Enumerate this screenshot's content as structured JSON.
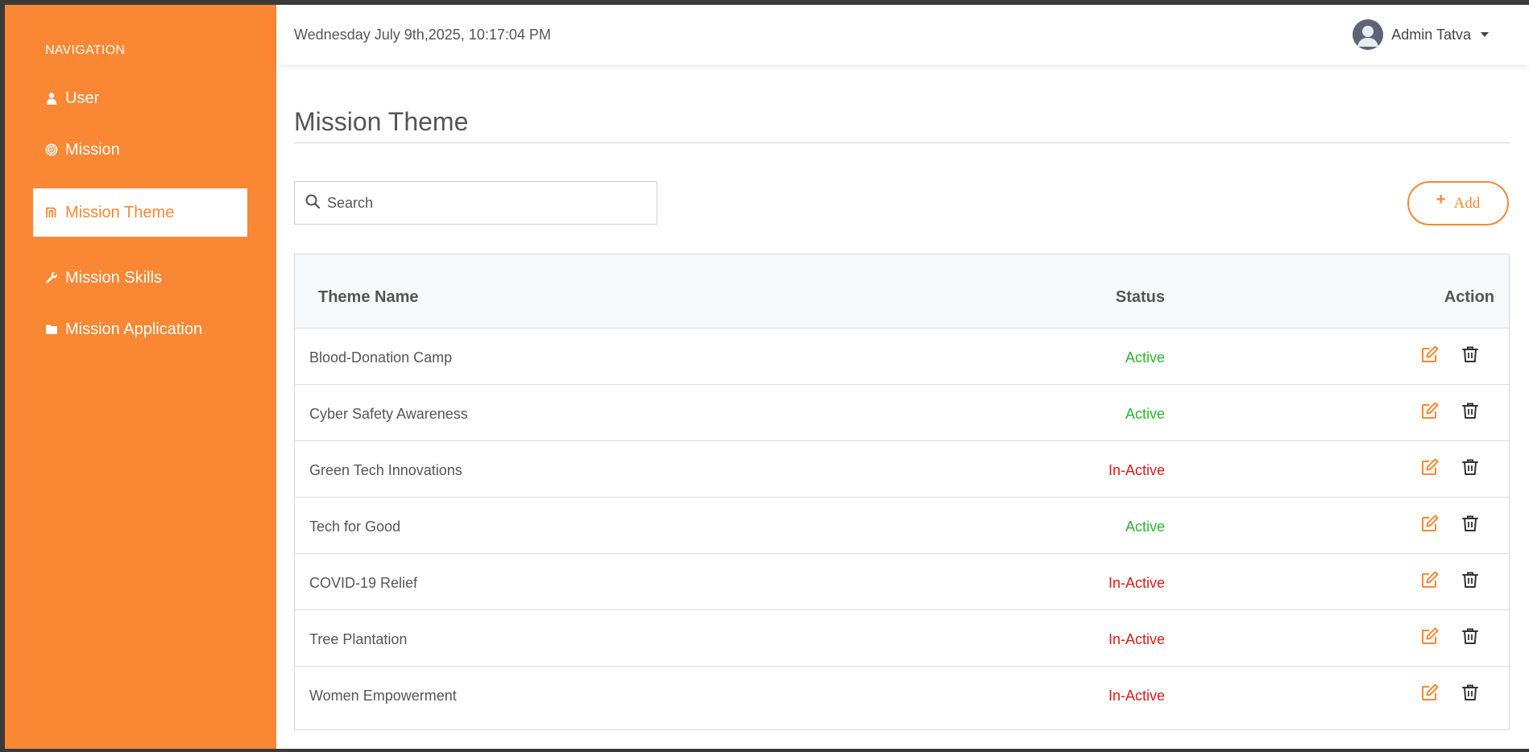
{
  "colors": {
    "brand": "#fa8733",
    "active": "#2ab82a",
    "inactive": "#e01818"
  },
  "sidebar": {
    "heading": "NAVIGATION",
    "items": [
      {
        "label": "User",
        "icon": "user-icon",
        "active": false
      },
      {
        "label": "Mission",
        "icon": "bullseye-icon",
        "active": false
      },
      {
        "label": "Mission Theme",
        "icon": "theme-icon",
        "active": true
      },
      {
        "label": "Mission Skills",
        "icon": "wrench-icon",
        "active": false
      },
      {
        "label": "Mission Application",
        "icon": "folder-icon",
        "active": false
      }
    ]
  },
  "header": {
    "datetime": "Wednesday July 9th,2025, 10:17:04 PM",
    "user_name": "Admin Tatva",
    "avatar_icon": "user-avatar-icon"
  },
  "main": {
    "title": "Mission Theme",
    "search_placeholder": "Search",
    "add_label": "Add",
    "table": {
      "columns": [
        "Theme Name",
        "Status",
        "Action"
      ],
      "rows": [
        {
          "name": "Blood-Donation Camp",
          "status": "Active"
        },
        {
          "name": "Cyber Safety Awareness",
          "status": "Active"
        },
        {
          "name": "Green Tech Innovations",
          "status": "In-Active"
        },
        {
          "name": "Tech for Good",
          "status": "Active"
        },
        {
          "name": "COVID-19 Relief",
          "status": "In-Active"
        },
        {
          "name": "Tree Plantation",
          "status": "In-Active"
        },
        {
          "name": "Women Empowerment",
          "status": "In-Active"
        }
      ]
    }
  }
}
